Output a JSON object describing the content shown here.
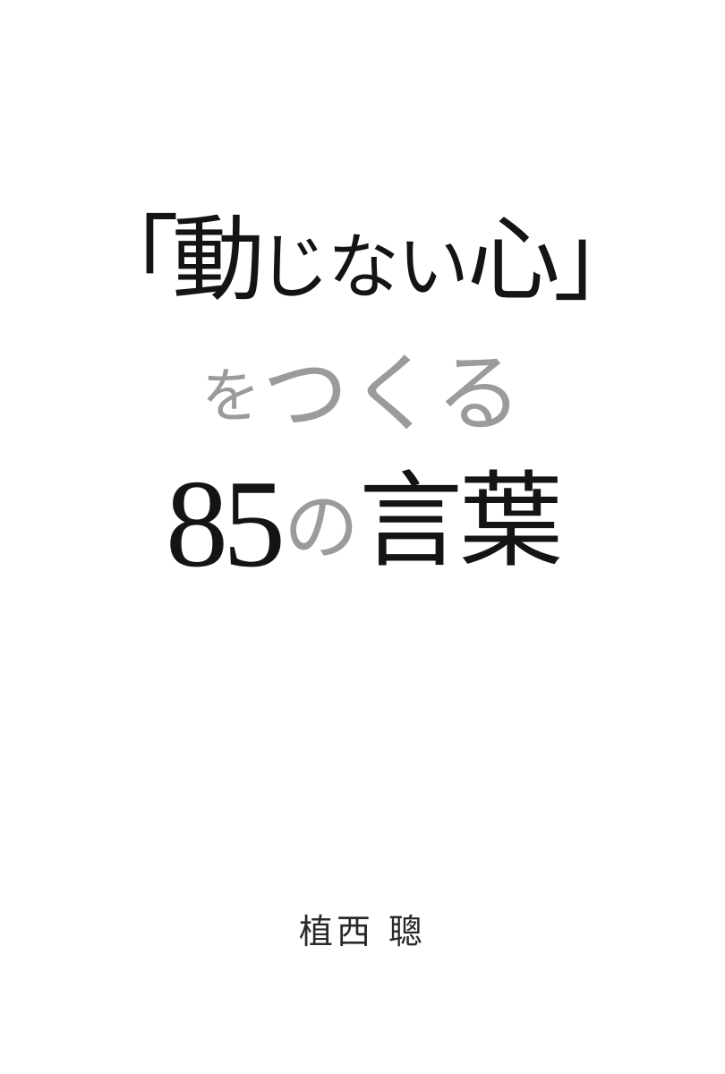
{
  "cover": {
    "title": {
      "line1": {
        "open_bracket": "「",
        "kanji": "動",
        "kana": "じない",
        "heart": "心",
        "close_bracket": "」"
      },
      "line2": {
        "wo": "を",
        "tsukuru": "つくる"
      },
      "line3": {
        "number": "85",
        "particle": "の",
        "words": "言葉"
      }
    },
    "author": "植西 聰",
    "colors": {
      "text_dark": "#141414",
      "text_gray": "#9b9b9b",
      "background": "#ffffff"
    }
  }
}
